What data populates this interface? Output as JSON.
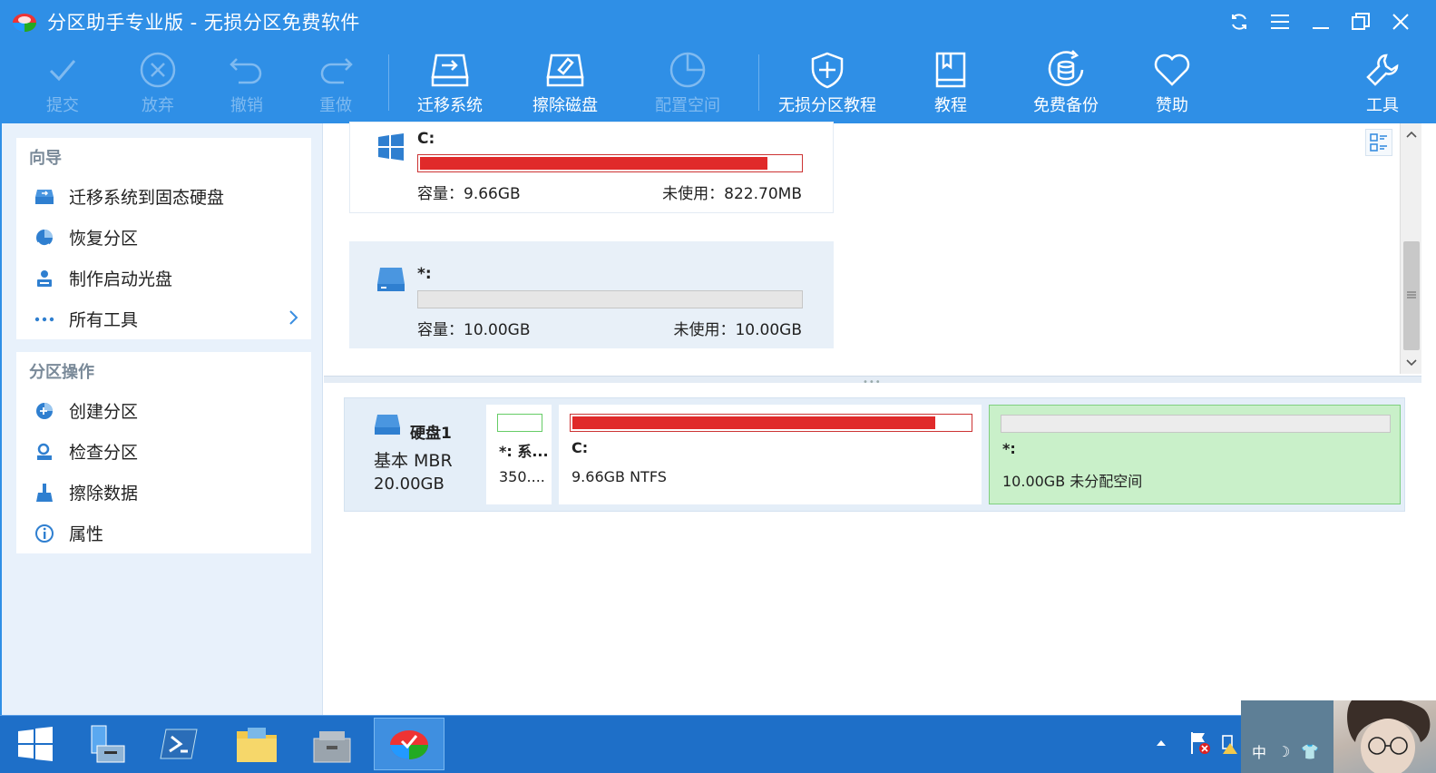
{
  "window": {
    "title": "分区助手专业版 - 无损分区免费软件"
  },
  "toolbar": {
    "buttons": [
      {
        "label": "提交",
        "icon": "check-icon",
        "enabled": false
      },
      {
        "label": "放弃",
        "icon": "x-circle-icon",
        "enabled": false
      },
      {
        "label": "撤销",
        "icon": "undo-icon",
        "enabled": false
      },
      {
        "label": "重做",
        "icon": "redo-icon",
        "enabled": false
      },
      {
        "label": "迁移系统",
        "icon": "migrate-disk-icon",
        "enabled": true
      },
      {
        "label": "擦除磁盘",
        "icon": "wipe-disk-icon",
        "enabled": true
      },
      {
        "label": "配置空间",
        "icon": "pie-clock-icon",
        "enabled": false
      },
      {
        "label": "无损分区教程",
        "icon": "shield-plus-icon",
        "enabled": true
      },
      {
        "label": "教程",
        "icon": "book-icon",
        "enabled": true
      },
      {
        "label": "免费备份",
        "icon": "backup-db-icon",
        "enabled": true
      },
      {
        "label": "赞助",
        "icon": "heart-icon",
        "enabled": true
      },
      {
        "label": "工具",
        "icon": "wrench-icon",
        "enabled": true
      }
    ]
  },
  "sidebar": {
    "wizard": {
      "title": "向导",
      "items": [
        {
          "label": "迁移系统到固态硬盘",
          "icon": "ssd-migrate-icon"
        },
        {
          "label": "恢复分区",
          "icon": "recover-pie-icon"
        },
        {
          "label": "制作启动光盘",
          "icon": "boot-disc-user-icon"
        },
        {
          "label": "所有工具",
          "icon": "ellipsis-icon"
        }
      ]
    },
    "operations": {
      "title": "分区操作",
      "items": [
        {
          "label": "创建分区",
          "icon": "create-pie-icon"
        },
        {
          "label": "检查分区",
          "icon": "check-user-icon"
        },
        {
          "label": "擦除数据",
          "icon": "broom-icon"
        },
        {
          "label": "属性",
          "icon": "info-icon"
        }
      ]
    }
  },
  "partitions": [
    {
      "name": "C:",
      "capacity": "容量：9.66GB",
      "unused": "未使用：822.70MB",
      "used_fraction": 0.915,
      "icon": "windows-icon"
    },
    {
      "name": "*:",
      "capacity": "容量：10.00GB",
      "unused": "未使用：10.00GB",
      "used_fraction": 0.0,
      "icon": "drive-icon"
    }
  ],
  "disk": {
    "name": "硬盘1",
    "type": "基本 MBR",
    "size": "20.00GB",
    "parts": [
      {
        "name": "*: 系...",
        "desc": "350....",
        "used_fraction": 0.08,
        "color": "#22bb22",
        "kind": "system"
      },
      {
        "name": "C:",
        "desc": "9.66GB NTFS",
        "used_fraction": 0.915,
        "color": "#e02a2a",
        "kind": "data"
      },
      {
        "name": "*:",
        "desc": "10.00GB 未分配空间",
        "used_fraction": 0.0,
        "color": "#e0e0e0",
        "kind": "free"
      }
    ]
  },
  "taskbar": {
    "apps": [
      "windows-start-icon",
      "server-manager-icon",
      "powershell-icon",
      "file-explorer-icon",
      "toolbox-icon",
      "partition-assistant-icon"
    ],
    "ime": {
      "lang": "中"
    }
  }
}
